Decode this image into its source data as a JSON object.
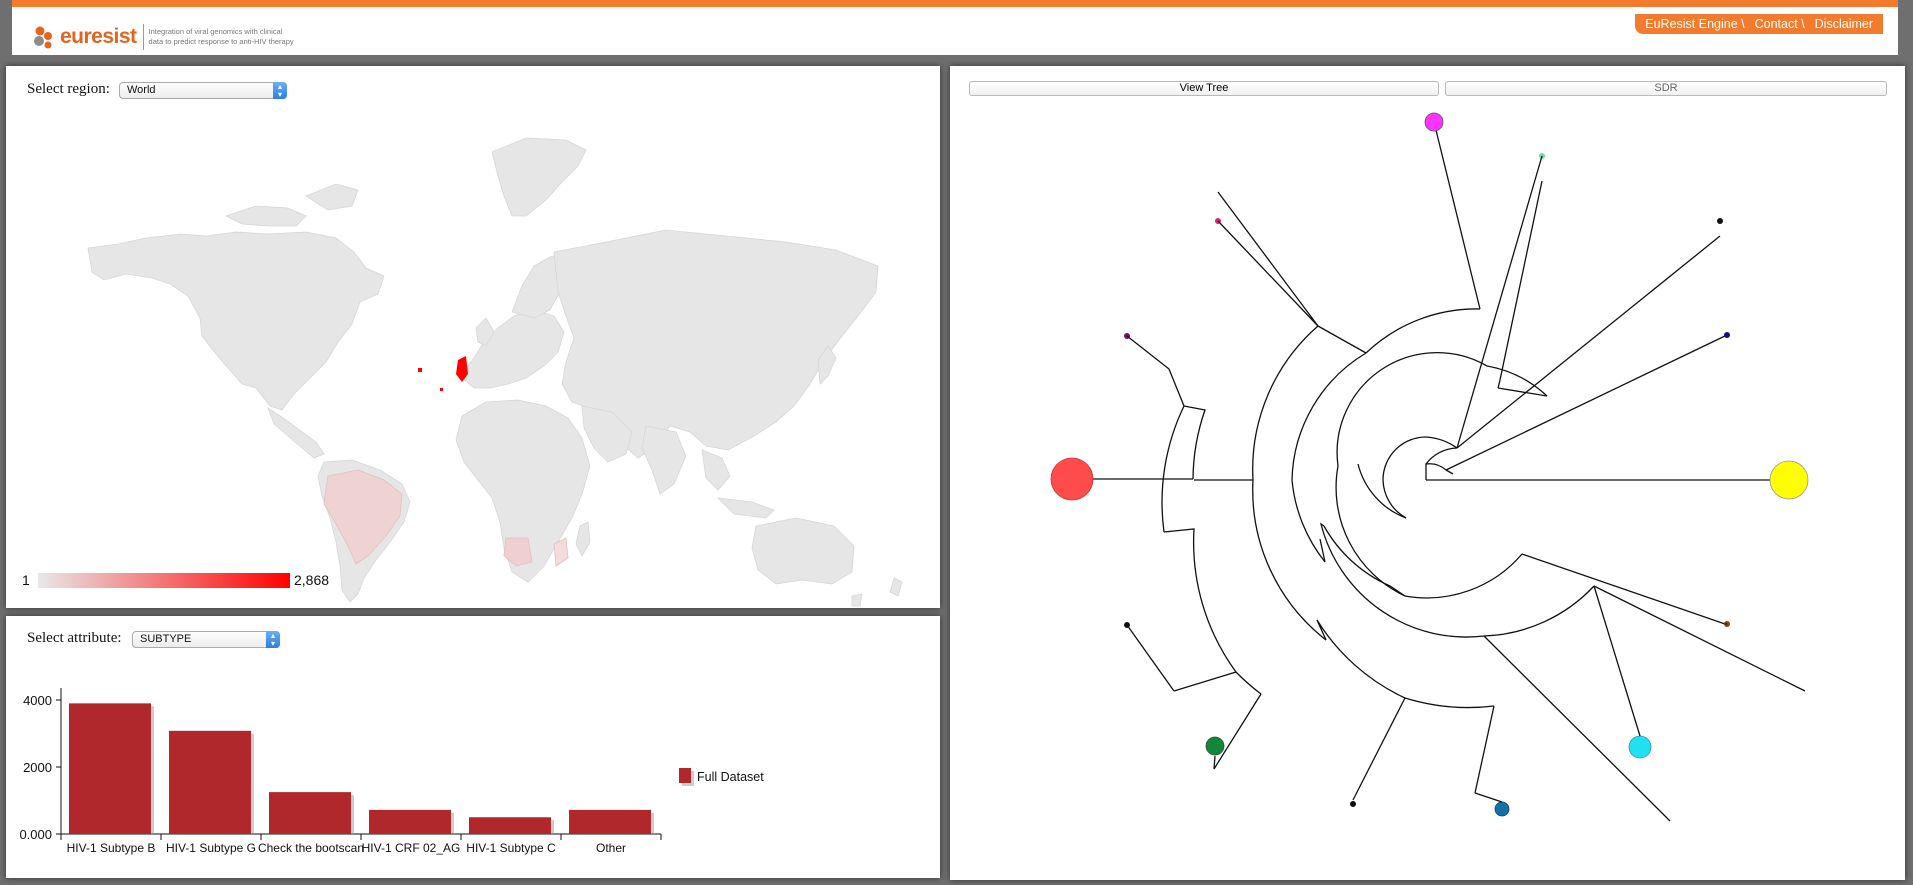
{
  "header": {
    "logo_text": "euresist",
    "tagline_line1": "Integration of viral genomics with clinical",
    "tagline_line2": "data to predict response to anti-HIV therapy",
    "nav": [
      "EuResist Engine \\",
      "Contact \\",
      "Disclaimer"
    ],
    "accent": "#f27b2e"
  },
  "map": {
    "region_label": "Select region:",
    "region_value": "World",
    "legend_min": "1",
    "legend_max": "2,868",
    "scale_low": "#e8e8e8",
    "scale_high": "#ff0000"
  },
  "attribute": {
    "label": "Select attribute:",
    "value": "SUBTYPE"
  },
  "chart_data": {
    "type": "bar",
    "categories": [
      "HIV-1 Subtype B",
      "HIV-1 Subtype G",
      "Check the bootscan",
      "HIV-1 CRF 02_AG",
      "HIV-1 Subtype C",
      "Other"
    ],
    "series": [
      {
        "name": "Full Dataset",
        "values": [
          3900,
          3080,
          1250,
          720,
          500,
          720
        ],
        "color": "#b0282c"
      }
    ],
    "ylim": [
      0,
      4000
    ],
    "yticks": [
      "4000",
      "2000",
      "0.000"
    ],
    "legend_position": "right"
  },
  "tree": {
    "buttons": [
      "View Tree",
      "SDR"
    ],
    "node_colors": {
      "yellow": "#ffff00",
      "red": "#ff4b4b",
      "magenta": "#ff33ff",
      "mint": "#66ddaa",
      "black": "#111111",
      "navy": "#101080",
      "pink": "#e0207a",
      "purple": "#7a1060",
      "brown": "#7a4a10",
      "cyan": "#22e0f0",
      "blue": "#1670a8",
      "green": "#10883a"
    }
  }
}
